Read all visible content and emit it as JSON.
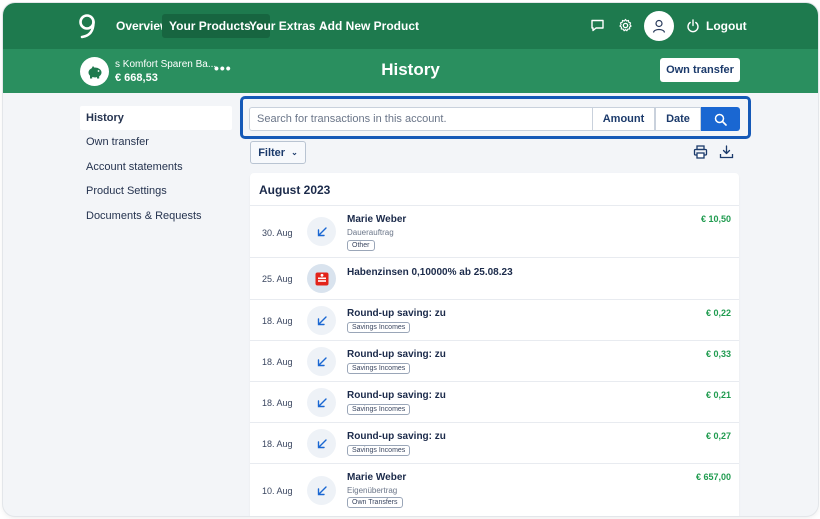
{
  "topnav": {
    "items": [
      {
        "label": "Overview"
      },
      {
        "label": "Your Products"
      },
      {
        "label": "Your Extras"
      },
      {
        "label": "Add New Product"
      }
    ],
    "logout_label": "Logout",
    "icons": [
      "logo-icon",
      "chat-icon",
      "gear-icon",
      "user-icon",
      "power-icon"
    ]
  },
  "header": {
    "account_name": "s Komfort Sparen Ba...",
    "account_balance": "€ 668,53",
    "more_label": "•••",
    "title": "History",
    "own_transfer_label": "Own transfer"
  },
  "sidebar": {
    "items": [
      {
        "label": "History"
      },
      {
        "label": "Own transfer"
      },
      {
        "label": "Account statements"
      },
      {
        "label": "Product Settings"
      },
      {
        "label": "Documents & Requests"
      }
    ]
  },
  "search": {
    "placeholder": "Search for transactions in this account.",
    "amount_label": "Amount",
    "date_label": "Date"
  },
  "toolbar": {
    "filter_label": "Filter"
  },
  "transactions": {
    "month": "August 2023",
    "rows": [
      {
        "date": "30. Aug",
        "title": "Marie Weber",
        "subtitle": "Dauerauftrag",
        "tag": "Other",
        "amount": "€ 10,50",
        "icon": "incoming-arrow-icon"
      },
      {
        "date": "25. Aug",
        "title": "Habenzinsen 0,10000% ab 25.08.23",
        "subtitle": "",
        "tag": "",
        "amount": "",
        "icon": "bank-logo-icon"
      },
      {
        "date": "18. Aug",
        "title": "Round-up saving: zu",
        "subtitle": "",
        "tag": "Savings Incomes",
        "amount": "€ 0,22",
        "icon": "incoming-arrow-icon"
      },
      {
        "date": "18. Aug",
        "title": "Round-up saving: zu",
        "subtitle": "",
        "tag": "Savings Incomes",
        "amount": "€ 0,33",
        "icon": "incoming-arrow-icon"
      },
      {
        "date": "18. Aug",
        "title": "Round-up saving: zu",
        "subtitle": "",
        "tag": "Savings Incomes",
        "amount": "€ 0,21",
        "icon": "incoming-arrow-icon"
      },
      {
        "date": "18. Aug",
        "title": "Round-up saving: zu",
        "subtitle": "",
        "tag": "Savings Incomes",
        "amount": "€ 0,27",
        "icon": "incoming-arrow-icon"
      },
      {
        "date": "10. Aug",
        "title": "Marie Weber",
        "subtitle": "Eigenübertrag",
        "tag": "Own Transfers",
        "amount": "€ 657,00",
        "icon": "incoming-arrow-icon"
      }
    ]
  },
  "colors": {
    "brand_green": "#1e7a4e",
    "band_green": "#2a8f5f",
    "accent_blue": "#1a67d2",
    "amount_green": "#1f9b4f"
  }
}
